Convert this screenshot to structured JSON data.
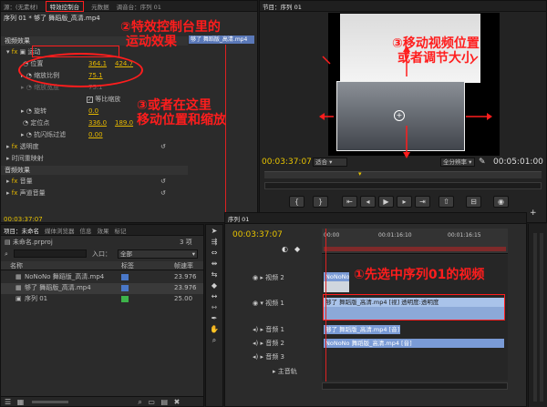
{
  "source_panel": {
    "tabs": [
      "源：(无素材)",
      "特效控制台",
      "元数据",
      "调音台：序列 01"
    ],
    "sequence_clip": "序列 01 * 够了 舞蹈版_高清.mp4",
    "clip_label": "够了 舞蹈版_高清.mp4",
    "video_effects": "视频效果",
    "motion": "运动",
    "position_label": "位置",
    "position_x": "364.1",
    "position_y": "424.7",
    "scale_label": "缩放比例",
    "scale_value": "75.1",
    "scale_width_label": "缩放宽度",
    "scale_width_value": "75.1",
    "uniform_scale": "等比缩放",
    "rotation_label": "旋转",
    "rotation_value": "0.0",
    "anchor_label": "定位点",
    "anchor_x": "336.0",
    "anchor_y": "189.0",
    "flicker_label": "抗闪烁过滤",
    "flicker_value": "0.00",
    "opacity": "透明度",
    "time_remap": "时间重映射",
    "audio_effects": "音频效果",
    "volume": "音量",
    "channel_volume": "声道音量",
    "timecode": "00:03:37:07"
  },
  "program_panel": {
    "title": "节目：序列 01",
    "timecode": "00:03:37:07",
    "fit": "适合",
    "quality": "全分辨率",
    "duration": "00:05:01:00"
  },
  "project_panel": {
    "tabs": [
      "项目：未命名",
      "媒体浏览器",
      "信息",
      "效果",
      "标记"
    ],
    "project_file": "未命名.prproj",
    "item_count": "3 项",
    "entry_label": "入口：",
    "entry_value": "全部",
    "col_name": "名称",
    "col_label": "标签",
    "col_rate": "帧速率",
    "items": [
      {
        "name": "NoNoNo 舞蹈版_高清.mp4",
        "rate": "23.976",
        "color": "#4a78c8"
      },
      {
        "name": "够了 舞蹈版_高清.mp4",
        "rate": "23.976",
        "color": "#4a78c8"
      },
      {
        "name": "序列 01",
        "rate": "25.00",
        "color": "#3db34a"
      }
    ]
  },
  "timeline_panel": {
    "tab": "序列 01",
    "timecode": "00:03:37:07",
    "ruler": [
      "00:00",
      "00:01:16:10",
      "00:01:16:15"
    ],
    "tracks": [
      "视频 2",
      "视频 1",
      "音频 1",
      "音频 2",
      "音频 3",
      "主音轨"
    ],
    "clips": {
      "v2": "NoNoNo",
      "v1": "够了 舞蹈版_高清.mp4 [视] 透明度:透明度",
      "a1": "够了 舞蹈版_高清.mp4 [音]",
      "a2": "NoNoNo 舞蹈版_高清.mp4 [音]"
    }
  },
  "annotations": {
    "a1": "①先选中序列01的视频",
    "a2_line1": "②特效控制台里的",
    "a2_line2": "运动效果",
    "a3_line1": "③或者在这里",
    "a3_line2": "移动位置和缩放",
    "a4_line1": "③移动视频位置",
    "a4_line2": "或者调节大小"
  },
  "colors": {
    "annotation_red": "#ff1d1d",
    "value_yellow": "#e6b800",
    "timecode_yellow": "#e8c400",
    "clip_blue": "#7a9bd6",
    "clip_lightblue": "#a9c3ea"
  }
}
